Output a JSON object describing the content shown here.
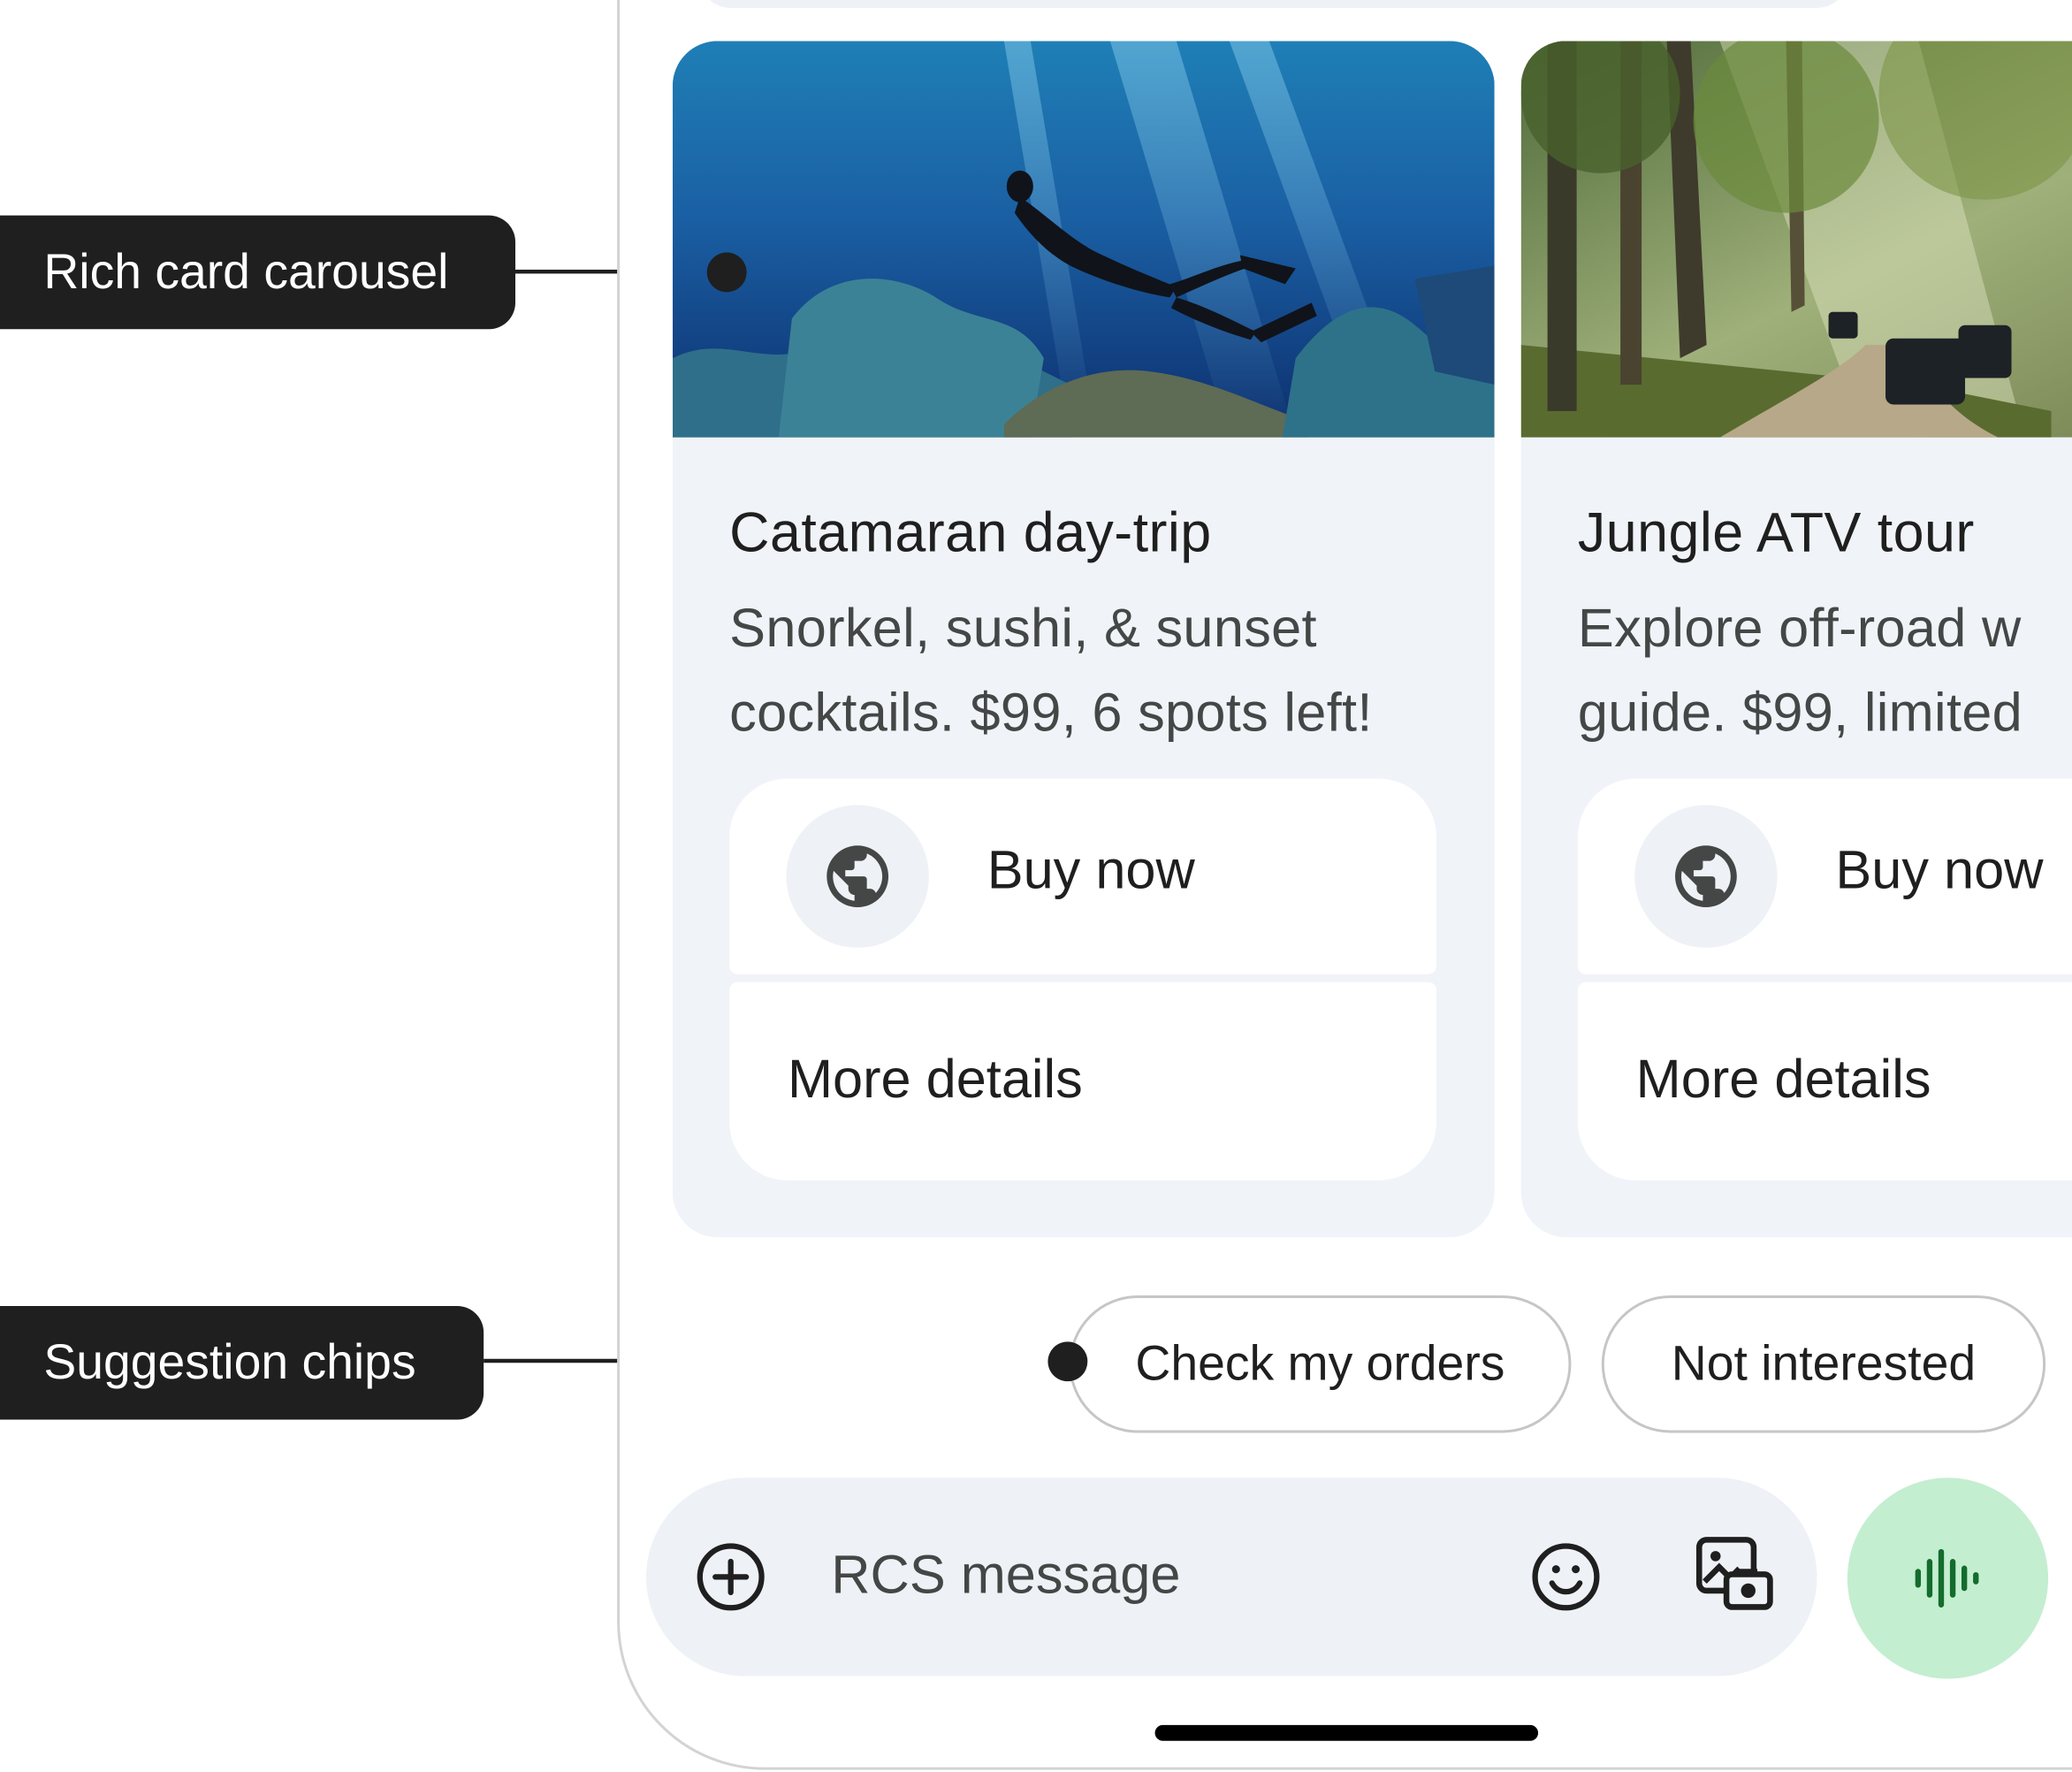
{
  "annotations": {
    "rich_card_carousel": "Rich card carousel",
    "suggestion_chips": "Suggestion chips"
  },
  "cards": [
    {
      "title": "Catamaran day-trip",
      "description_line1": "Snorkel, sushi, & sunset",
      "description_line2": "cocktails. $99, 6 spots left!",
      "image": "underwater snorkeler photo",
      "primary_action": {
        "label": "Buy now",
        "icon": "globe-icon"
      },
      "secondary_action": {
        "label": "More details"
      }
    },
    {
      "title": "Jungle ATV tour",
      "description_line1": "Explore off-road w",
      "description_line2": "guide. $99, limited",
      "image": "jungle jeeps photo",
      "primary_action": {
        "label": "Buy now",
        "icon": "globe-icon"
      },
      "secondary_action": {
        "label": "More details"
      }
    }
  ],
  "chips": [
    "Check my orders",
    "Not interested"
  ],
  "compose": {
    "placeholder": "RCS message",
    "icons": [
      "add-icon",
      "emoji-icon",
      "gallery-icon",
      "voice-icon"
    ]
  },
  "colors": {
    "card_bg": "#f0f3f8",
    "callout_bg": "#1f1f1f",
    "voice_button": "#c4eed0",
    "voice_icon": "#146c2e",
    "chip_border": "#c4c7c5"
  }
}
